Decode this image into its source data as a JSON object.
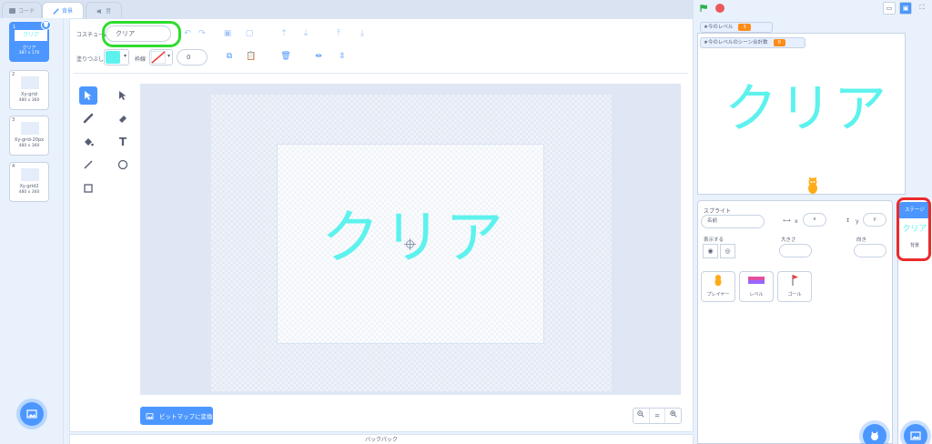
{
  "tabs": [
    {
      "label": "コード",
      "icon": "code-icon"
    },
    {
      "label": "背景",
      "icon": "brush-icon"
    },
    {
      "label": "音",
      "icon": "speaker-icon"
    }
  ],
  "costumes": [
    {
      "number": "1",
      "name": "クリア",
      "size": "387 x 176",
      "thumb_text": "クリア"
    },
    {
      "number": "2",
      "name": "Xy-grid",
      "size": "480 x 360"
    },
    {
      "number": "3",
      "name": "Xy-grid-20px",
      "size": "480 x 360"
    },
    {
      "number": "4",
      "name": "Xy-grid2",
      "size": "480 x 360"
    }
  ],
  "editor": {
    "costume_label": "コスチューム",
    "costume_name": "クリア",
    "fill_label": "塗りつぶし",
    "stroke_label": "枠線",
    "stroke_width": "0",
    "fill_color": "#5df2ed",
    "canvas_text": "クリア",
    "bitmap_button": "ビットマップに変換",
    "zoom_reset": "="
  },
  "backpack_label": "バックパック",
  "stage": {
    "monitors": [
      {
        "label": "★今のレベル",
        "value": "3"
      },
      {
        "label": "★今のレベルのシーン合計数",
        "value": "0"
      }
    ],
    "stage_text": "クリア"
  },
  "sprite_panel": {
    "sprite_label": "スプライト",
    "name_placeholder": "名前",
    "x_label": "x",
    "x_value": "x",
    "y_label": "y",
    "y_value": "y",
    "show_label": "表示する",
    "size_label": "大きさ",
    "direction_label": "向き",
    "sprites": [
      {
        "name": "プレイヤー"
      },
      {
        "name": "レベル"
      },
      {
        "name": "ゴール"
      }
    ]
  },
  "stage_pane": {
    "header": "ステージ",
    "thumb_text": "クリア",
    "backdrops_label": "背景"
  },
  "colors": {
    "accent": "#4c97ff",
    "cyan_text": "#5df2ed",
    "green_highlight": "#2fdc2f",
    "red_highlight": "#ec2a2a"
  }
}
